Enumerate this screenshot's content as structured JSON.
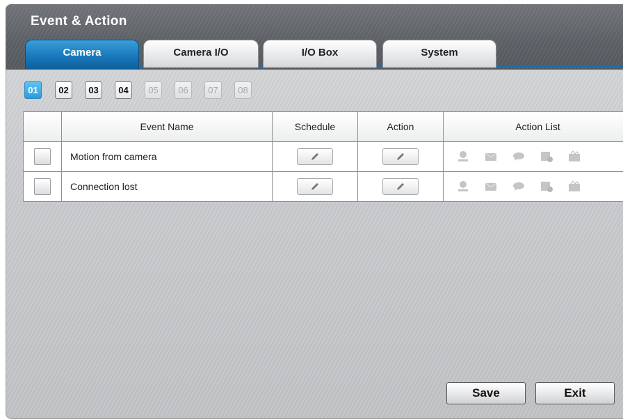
{
  "window": {
    "title": "Event & Action"
  },
  "tabs": [
    {
      "label": "Camera",
      "active": true
    },
    {
      "label": "Camera I/O",
      "active": false
    },
    {
      "label": "I/O Box",
      "active": false
    },
    {
      "label": "System",
      "active": false
    }
  ],
  "channels": [
    {
      "label": "01",
      "state": "selected"
    },
    {
      "label": "02",
      "state": "enabled"
    },
    {
      "label": "03",
      "state": "enabled"
    },
    {
      "label": "04",
      "state": "enabled"
    },
    {
      "label": "05",
      "state": "disabled"
    },
    {
      "label": "06",
      "state": "disabled"
    },
    {
      "label": "07",
      "state": "disabled"
    },
    {
      "label": "08",
      "state": "disabled"
    }
  ],
  "table": {
    "headers": [
      "",
      "Event Name",
      "Schedule",
      "Action",
      "Action List"
    ],
    "rows": [
      {
        "event_name": "Motion from camera",
        "checked": false,
        "actions": [
          "record-icon",
          "email-icon",
          "message-icon",
          "ftp-icon",
          "alarm-output-icon"
        ]
      },
      {
        "event_name": "Connection lost",
        "checked": false,
        "actions": [
          "record-icon",
          "email-icon",
          "message-icon",
          "ftp-icon",
          "alarm-output-icon"
        ]
      }
    ]
  },
  "buttons": {
    "save": "Save",
    "exit": "Exit"
  },
  "colors": {
    "accent": "#1c7cbf",
    "header": "#5b5f64",
    "disabled_icon": "#c3c5c8"
  }
}
